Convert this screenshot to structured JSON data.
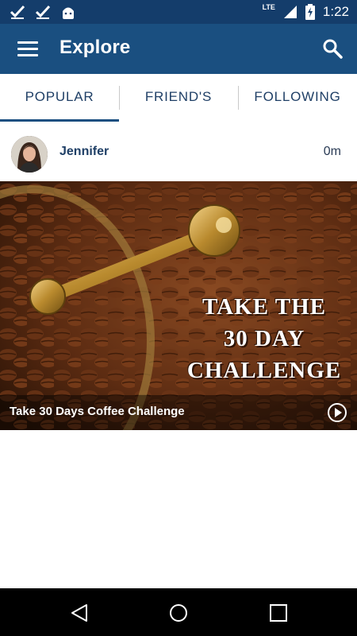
{
  "status_bar": {
    "time": "1:22",
    "network": "LTE",
    "icons": [
      "checkmark-icon",
      "checkmark-icon",
      "android-icon",
      "signal-icon",
      "battery-charging-icon"
    ]
  },
  "app_bar": {
    "title": "Explore",
    "menu_icon": "hamburger-menu-icon",
    "search_icon": "search-icon"
  },
  "tabs": [
    {
      "label": "POPULAR",
      "active": true
    },
    {
      "label": "FRIEND'S",
      "active": false
    },
    {
      "label": "FOLLOWING",
      "active": false
    }
  ],
  "post": {
    "author": "Jennifer",
    "time": "0m",
    "image_text": [
      "TAKE THE",
      "30 DAY",
      "CHALLENGE"
    ],
    "caption": "Take 30 Days Coffee Challenge",
    "play_icon": "play-circle-icon"
  },
  "nav_bar": {
    "buttons": [
      "back-icon",
      "home-icon",
      "recents-icon"
    ]
  },
  "colors": {
    "status_bar": "#143d6b",
    "app_bar": "#1a4f80",
    "tab_text": "#1f3f66",
    "active_indicator": "#1a4f80"
  }
}
